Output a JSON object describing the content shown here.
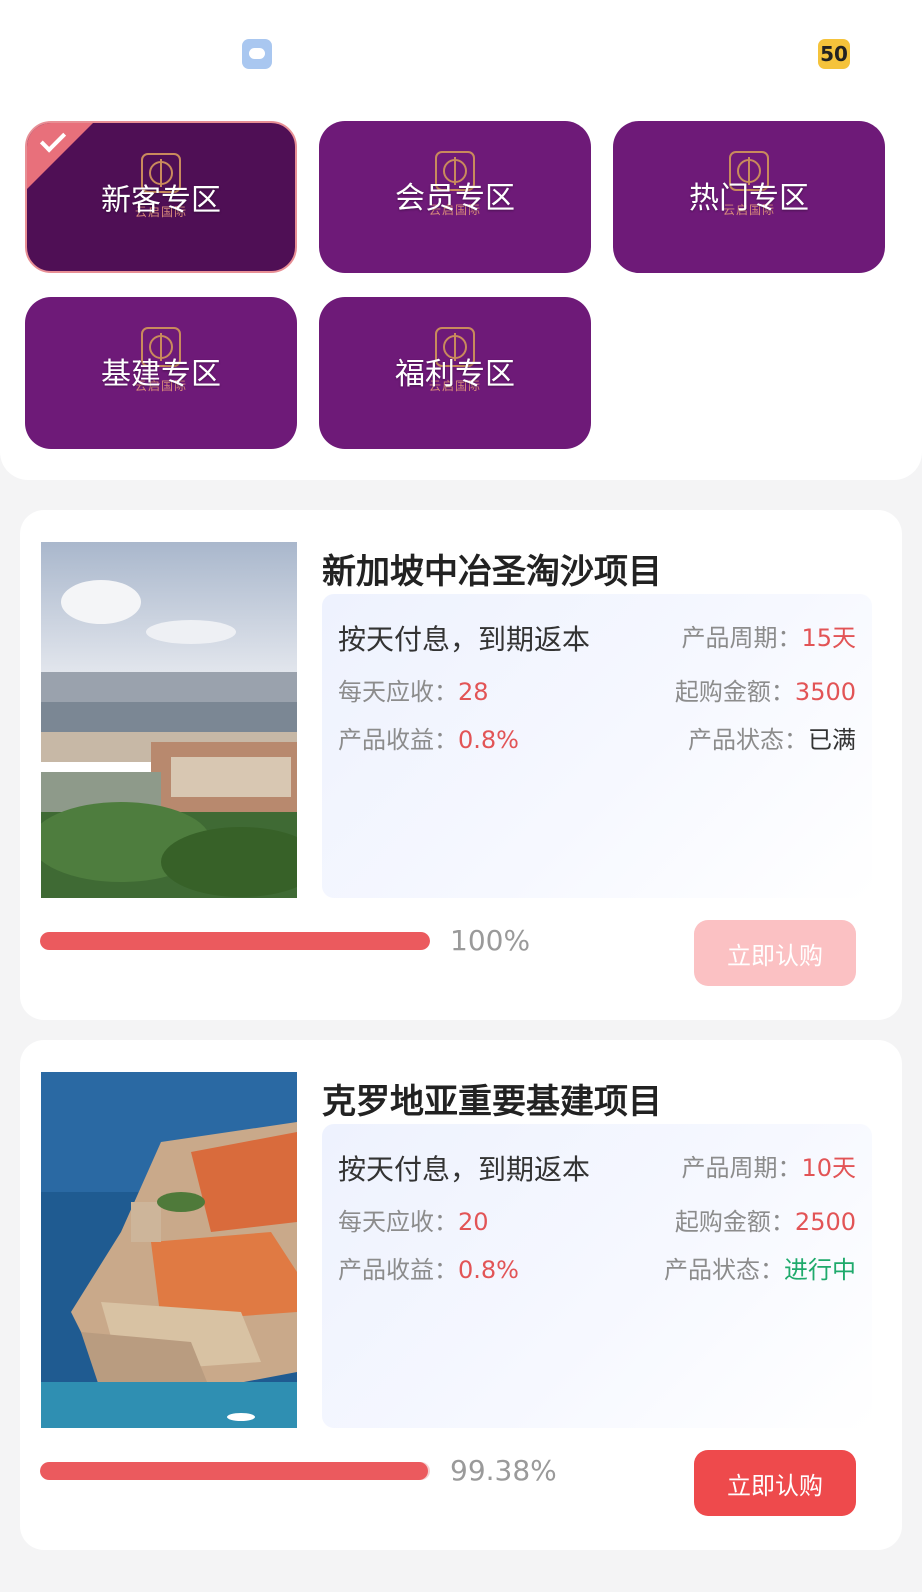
{
  "status_bar": {
    "weather_icon": "cloud-icon",
    "badge_text": "50"
  },
  "zones": {
    "logo_caption": "云启国际",
    "items": [
      {
        "label": "新客专区",
        "selected": true
      },
      {
        "label": "会员专区",
        "selected": false
      },
      {
        "label": "热门专区",
        "selected": false
      },
      {
        "label": "基建专区",
        "selected": false
      },
      {
        "label": "福利专区",
        "selected": false
      }
    ]
  },
  "colors": {
    "zone_bg": "#6e1a78",
    "zone_active_bg": "#4f0f55",
    "accent_red": "#ee4a4c",
    "status_green": "#1faa6c"
  },
  "products": [
    {
      "title": "新加坡中冶圣淘沙项目",
      "method": "按天付息，到期返本",
      "period_label": "产品周期：",
      "period_value": "15天",
      "daily_label": "每天应收：",
      "daily_value": "28",
      "min_label": "起购金额：",
      "min_value": "3500",
      "yield_label": "产品收益：",
      "yield_value": "0.8%",
      "status_label": "产品状态：",
      "status_value": "已满",
      "progress": 100,
      "progress_text": "100%",
      "button_label": "立即认购",
      "button_enabled": false,
      "image": "singapore-sentosa-aerial-photo"
    },
    {
      "title": "克罗地亚重要基建项目",
      "method": "按天付息，到期返本",
      "period_label": "产品周期：",
      "period_value": "10天",
      "daily_label": "每天应收：",
      "daily_value": "20",
      "min_label": "起购金额：",
      "min_value": "2500",
      "yield_label": "产品收益：",
      "yield_value": "0.8%",
      "status_label": "产品状态：",
      "status_value": "进行中",
      "progress": 99.38,
      "progress_text": "99.38%",
      "button_label": "立即认购",
      "button_enabled": true,
      "image": "croatia-dubrovnik-coast-photo"
    }
  ]
}
